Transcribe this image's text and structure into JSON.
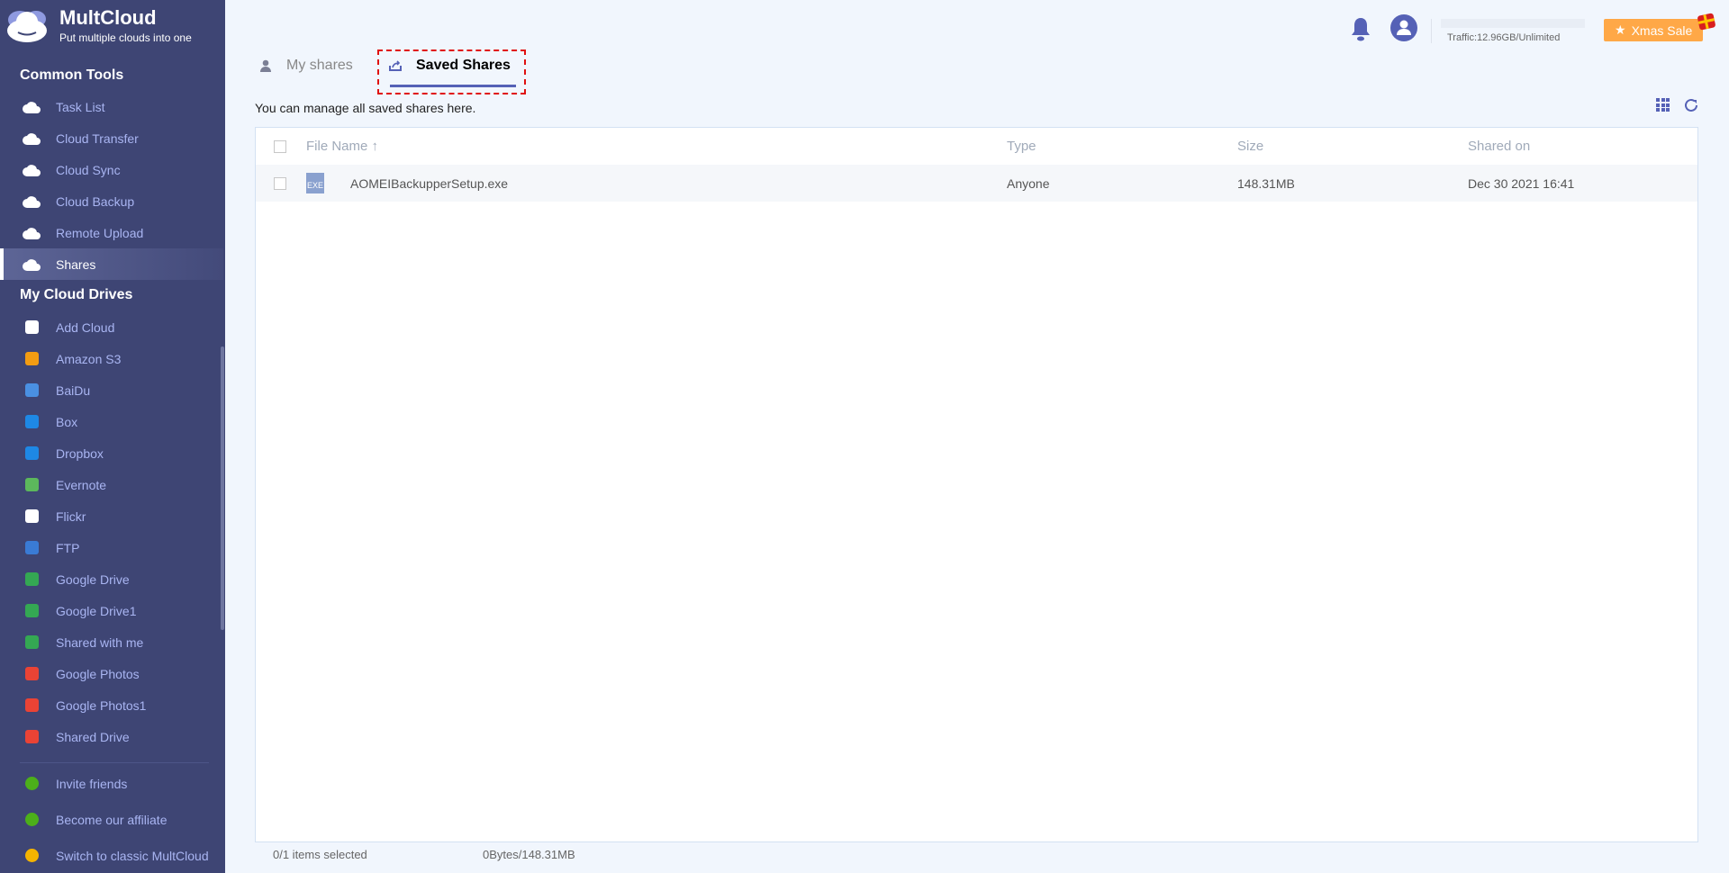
{
  "logo": {
    "title": "MultCloud",
    "subtitle": "Put multiple clouds into one"
  },
  "sidebar": {
    "common_tools": "Common Tools",
    "tools": [
      {
        "label": "Task List",
        "icon": "clipboard-icon"
      },
      {
        "label": "Cloud Transfer",
        "icon": "cloud-transfer-icon"
      },
      {
        "label": "Cloud Sync",
        "icon": "cloud-sync-icon"
      },
      {
        "label": "Cloud Backup",
        "icon": "cloud-backup-icon"
      },
      {
        "label": "Remote Upload",
        "icon": "cloud-upload-icon"
      },
      {
        "label": "Shares",
        "icon": "cloud-share-icon"
      }
    ],
    "my_cloud_drives": "My Cloud Drives",
    "drives": [
      {
        "label": "Add Cloud",
        "color": "#ffffff"
      },
      {
        "label": "Amazon S3",
        "color": "#f39c12"
      },
      {
        "label": "BaiDu",
        "color": "#4a90e2"
      },
      {
        "label": "Box",
        "color": "#1e88e5"
      },
      {
        "label": "Dropbox",
        "color": "#1e88e5"
      },
      {
        "label": "Evernote",
        "color": "#5cb85c"
      },
      {
        "label": "Flickr",
        "color": "#ffffff"
      },
      {
        "label": "FTP",
        "color": "#3a7bd5"
      },
      {
        "label": "Google Drive",
        "color": "#34a853"
      },
      {
        "label": "Google Drive1",
        "color": "#34a853"
      },
      {
        "label": "Shared with me",
        "color": "#34a853"
      },
      {
        "label": "Google Photos",
        "color": "#ea4335"
      },
      {
        "label": "Google Photos1",
        "color": "#ea4335"
      },
      {
        "label": "Shared Drive",
        "color": "#ea4335"
      }
    ],
    "extras": [
      {
        "label": "Invite friends",
        "color": "#4caf1a"
      },
      {
        "label": "Become our affiliate",
        "color": "#4caf1a"
      },
      {
        "label": "Switch to classic MultCloud",
        "color": "#f5b400"
      }
    ]
  },
  "header": {
    "traffic": "Traffic:12.96GB/Unlimited",
    "sale": "Xmas Sale"
  },
  "tabs": {
    "my_shares": "My shares",
    "saved_shares": "Saved Shares"
  },
  "description": "You can manage all saved shares here.",
  "table": {
    "columns": [
      "File Name",
      "Type",
      "Size",
      "Shared on"
    ],
    "sort_arrow": "↑",
    "rows": [
      {
        "name": "AOMEIBackupperSetup.exe",
        "type": "Anyone",
        "size": "148.31MB",
        "shared_on": "Dec 30 2021 16:41",
        "icon_label": "EXE"
      }
    ]
  },
  "footer": {
    "selected": "0/1 items selected",
    "size": "0Bytes/148.31MB"
  }
}
